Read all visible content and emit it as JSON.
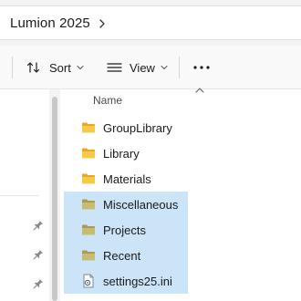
{
  "address": {
    "breadcrumb": "Lumion 2025",
    "chevron_icon": "chevron-right-icon"
  },
  "toolbar": {
    "sort_label": "Sort",
    "view_label": "View",
    "more_icon": "ellipsis-icon"
  },
  "file_list": {
    "column_name": "Name",
    "items": [
      {
        "name": "GroupLibrary",
        "type": "folder",
        "selected": false
      },
      {
        "name": "Library",
        "type": "folder",
        "selected": false
      },
      {
        "name": "Materials",
        "type": "folder",
        "selected": false
      },
      {
        "name": "Miscellaneous",
        "type": "folder",
        "selected": true
      },
      {
        "name": "Projects",
        "type": "folder",
        "selected": true
      },
      {
        "name": "Recent",
        "type": "folder",
        "selected": true
      },
      {
        "name": "settings25.ini",
        "type": "ini-file",
        "selected": true
      }
    ]
  },
  "colors": {
    "selection": "#cce4f7",
    "folder": "#f3c24a"
  }
}
